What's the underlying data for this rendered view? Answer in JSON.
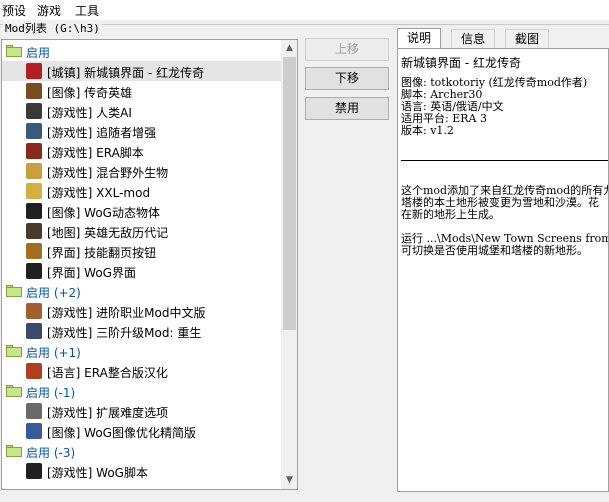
{
  "menu": [
    "预设",
    "游戏",
    "工具"
  ],
  "group_title": "Mod列表 (G:\\h3)",
  "tree": [
    {
      "type": "group",
      "label": "启用"
    },
    {
      "type": "mod",
      "label": "[城镇] 新城镇界面 - 红龙传奇",
      "icon": "red-circle-icon",
      "color": "#b02020",
      "selected": true
    },
    {
      "type": "mod",
      "label": "[图像] 传奇英雄",
      "icon": "portrait-icon",
      "color": "#7a4a20"
    },
    {
      "type": "mod",
      "label": "[游戏性] 人类AI",
      "icon": "ai-figure-icon",
      "color": "#3a3a3a"
    },
    {
      "type": "mod",
      "label": "[游戏性] 追随者增强",
      "icon": "follower-icon",
      "color": "#3a5a7a"
    },
    {
      "type": "mod",
      "label": "[游戏性] ERA脚本",
      "icon": "era-icon",
      "color": "#8a2a1a"
    },
    {
      "type": "mod",
      "label": "[游戏性] 混合野外生物",
      "icon": "creature-icon",
      "color": "#c8a040"
    },
    {
      "type": "mod",
      "label": "[游戏性] XXL-mod",
      "icon": "xxl-icon",
      "color": "#d4b040"
    },
    {
      "type": "mod",
      "label": "[图像] WoG动态物体",
      "icon": "wog-eye-icon",
      "color": "#202020"
    },
    {
      "type": "mod",
      "label": "[地图] 英雄无敌历代记",
      "icon": "map-icon",
      "color": "#4a3a2a"
    },
    {
      "type": "mod",
      "label": "[界面] 技能翻页按钮",
      "icon": "button-icon",
      "color": "#a07020"
    },
    {
      "type": "mod",
      "label": "[界面] WoG界面",
      "icon": "wog-eye-icon",
      "color": "#202020"
    },
    {
      "type": "group",
      "label": "启用 (+2)"
    },
    {
      "type": "mod",
      "label": "[游戏性] 进阶职业Mod中文版",
      "icon": "class-icon",
      "color": "#a06030"
    },
    {
      "type": "mod",
      "label": "[游戏性] 三阶升级Mod: 重生",
      "icon": "upgrade-icon",
      "color": "#3a4a6a"
    },
    {
      "type": "group",
      "label": "启用 (+1)"
    },
    {
      "type": "mod",
      "label": "[语言] ERA整合版汉化",
      "icon": "language-icon",
      "color": "#b04020"
    },
    {
      "type": "group",
      "label": "启用 (-1)"
    },
    {
      "type": "mod",
      "label": "[游戏性] 扩展难度选项",
      "icon": "difficulty-icon",
      "color": "#6a6a6a"
    },
    {
      "type": "mod",
      "label": "[图像] WoG图像优化精简版",
      "icon": "image-opt-icon",
      "color": "#3a5a9a"
    },
    {
      "type": "group",
      "label": "启用 (-3)"
    },
    {
      "type": "mod",
      "label": "[游戏性] WoG脚本",
      "icon": "wog-eye-icon",
      "color": "#202020"
    }
  ],
  "buttons": {
    "up": "上移",
    "down": "下移",
    "disable": "禁用"
  },
  "tabs": [
    "说明",
    "信息",
    "截图"
  ],
  "info": {
    "title": "新城镇界面 - 红龙传奇",
    "lines": "图像: totkotoriy (红龙传奇mod作者)\n脚本: Archer30\n语言: 英语/俄语/中文\n适用平台: ERA 3\n版本: v1.2",
    "body": "这个mod添加了来自红龙传奇mod的所有九\n塔楼的本土地形被变更为雪地和沙漠。花\n在新的地形上生成。\n\n运行 ...\\Mods\\New Town Screens from\n可切换是否使用城堡和塔楼的新地形。"
  }
}
